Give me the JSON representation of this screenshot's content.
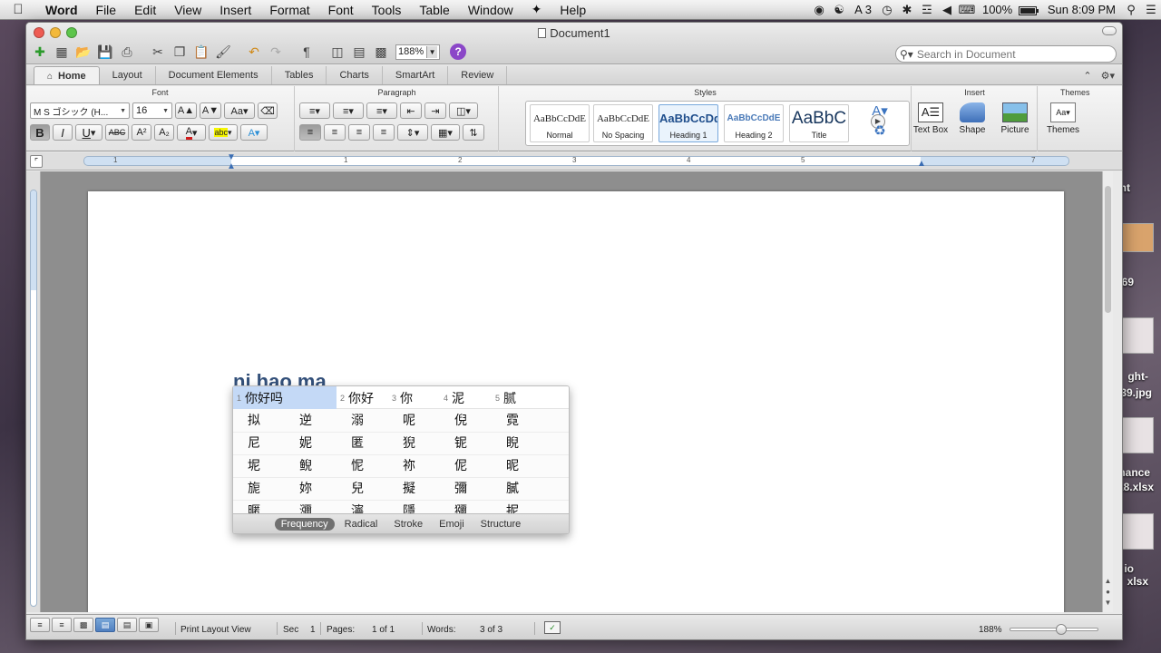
{
  "menubar": {
    "app_name": "Word",
    "items": [
      "File",
      "Edit",
      "View",
      "Insert",
      "Format",
      "Font",
      "Tools",
      "Table",
      "Window",
      "Help"
    ],
    "input_indicator": "A 3",
    "battery_percent": "100%",
    "battery_level": 1.0,
    "clock": "Sun 8:09 PM"
  },
  "desktop": {
    "labels": [
      "nt",
      "69",
      "ght-",
      "39.jpg",
      "nance",
      "18.xlsx",
      "io",
      "xlsx"
    ]
  },
  "window": {
    "title": "Document1",
    "zoom": "188%",
    "search_placeholder": "Search in Document"
  },
  "ribbon": {
    "tabs": [
      "Home",
      "Layout",
      "Document Elements",
      "Tables",
      "Charts",
      "SmartArt",
      "Review"
    ],
    "active_tab": "Home",
    "groups": {
      "font": "Font",
      "paragraph": "Paragraph",
      "styles": "Styles",
      "insert": "Insert",
      "themes": "Themes"
    },
    "font_name": "M S ゴシック (H...",
    "font_size": "16",
    "styles": [
      {
        "sample": "AaBbCcDdE",
        "label": "Normal"
      },
      {
        "sample": "AaBbCcDdE",
        "label": "No Spacing"
      },
      {
        "sample": "AaBbCcDd",
        "label": "Heading 1"
      },
      {
        "sample": "AaBbCcDdE",
        "label": "Heading 2"
      },
      {
        "sample": "AaBbC",
        "label": "Title"
      }
    ],
    "insert_buttons": [
      "Text Box",
      "Shape",
      "Picture"
    ],
    "themes_button": "Themes"
  },
  "ruler_marks": [
    "1",
    "1",
    "2",
    "3",
    "4",
    "5",
    "7"
  ],
  "document": {
    "ime_composition": "ni hao ma"
  },
  "ime": {
    "top_candidates": [
      {
        "num": "1",
        "chars": "你好吗"
      },
      {
        "num": "2",
        "chars": "你好"
      },
      {
        "num": "3",
        "chars": "你"
      },
      {
        "num": "4",
        "chars": "泥"
      },
      {
        "num": "5",
        "chars": "腻"
      }
    ],
    "grid": [
      [
        "拟",
        "逆",
        "溺",
        "呢",
        "倪",
        "霓"
      ],
      [
        "尼",
        "妮",
        "匿",
        "猊",
        "铌",
        "睨"
      ],
      [
        "坭",
        "鲵",
        "怩",
        "祢",
        "伲",
        "昵"
      ],
      [
        "旎",
        "妳",
        "兒",
        "擬",
        "彌",
        "膩"
      ],
      [
        "暱",
        "瀰",
        "濘",
        "隱",
        "獼",
        "抳"
      ]
    ],
    "modes": [
      "Frequency",
      "Radical",
      "Stroke",
      "Emoji",
      "Structure"
    ],
    "active_mode": "Frequency"
  },
  "statusbar": {
    "view": "Print Layout View",
    "sec_label": "Sec",
    "sec_value": "1",
    "pages_label": "Pages:",
    "pages_value": "1 of 1",
    "words_label": "Words:",
    "words_value": "3 of 3",
    "zoom": "188%",
    "zoom_slider_fraction": 0.58
  }
}
